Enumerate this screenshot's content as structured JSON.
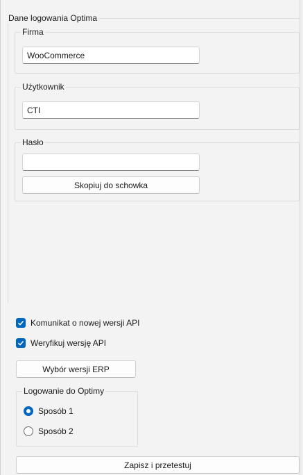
{
  "main_group": {
    "legend": "Dane logowania Optima"
  },
  "firma": {
    "legend": "Firma",
    "value": "WooCommerce"
  },
  "uzytkownik": {
    "legend": "Użytkownik",
    "value": "CTI"
  },
  "haslo": {
    "legend": "Hasło",
    "value": "",
    "copy_button": "Skopiuj do schowka"
  },
  "options": {
    "api_notice": {
      "label": "Komunikat o nowej wersji API",
      "checked": true
    },
    "verify_api": {
      "label": "Weryfikuj wersję API",
      "checked": true
    },
    "erp_button": "Wybór wersji ERP"
  },
  "login_group": {
    "legend": "Logowanie do Optimy",
    "options": [
      "Sposób 1",
      "Sposób 2"
    ],
    "selected": "Sposób 1"
  },
  "save_button": "Zapisz i przetestuj",
  "colors": {
    "accent": "#0067c0",
    "background": "#f3f3f3"
  }
}
